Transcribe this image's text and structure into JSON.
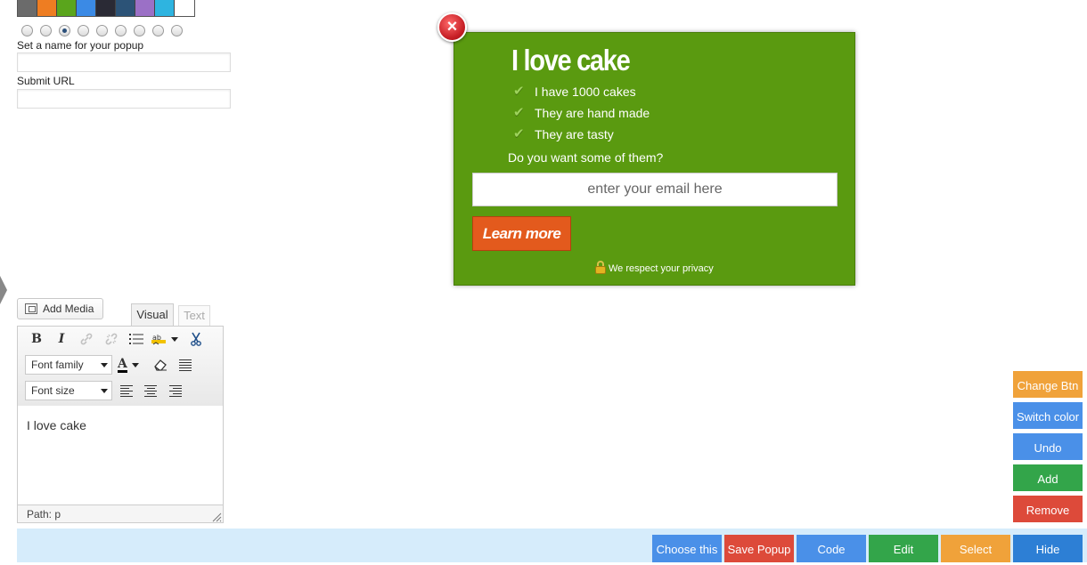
{
  "swatches": [
    "#6b6b6b",
    "#ee7d22",
    "#5aa51c",
    "#3b8ae5",
    "#2a2a35",
    "#2c5377",
    "#9b70c6",
    "#2eb4e0",
    "#ffffff"
  ],
  "radio_selected_index": 2,
  "radio_count": 9,
  "form": {
    "name_label": "Set a name for your popup",
    "name_value": "",
    "url_label": "Submit URL",
    "url_value": ""
  },
  "popup": {
    "close_icon": "×",
    "title": "I love cake",
    "features": [
      "I have 1000 cakes",
      "They are hand made",
      "They are tasty"
    ],
    "check_icon": "✔",
    "question": "Do you want some of them?",
    "email_placeholder": "enter your email here",
    "button_label": "Learn more",
    "privacy_text": "We respect your privacy",
    "bg_color": "#5a9a10",
    "button_color": "#e35a1d"
  },
  "editor": {
    "add_media_label": "Add Media",
    "tab_visual": "Visual",
    "tab_text": "Text",
    "bold": "B",
    "italic": "I",
    "font_family_label": "Font family",
    "font_size_label": "Font size",
    "text_color_letter": "A",
    "content": "I love cake",
    "path": "Path: p"
  },
  "side_buttons": [
    {
      "label": "Change Btn",
      "color": "#f0a23a"
    },
    {
      "label": "Switch color",
      "color": "#4a90e8"
    },
    {
      "label": "Undo",
      "color": "#4a90e8"
    },
    {
      "label": "Add",
      "color": "#33a54a"
    },
    {
      "label": "Remove",
      "color": "#dd4a3a"
    }
  ],
  "bottom_buttons": [
    {
      "label": "Choose this",
      "color": "#4a90e8"
    },
    {
      "label": "Save Popup",
      "color": "#dd4a3a"
    },
    {
      "label": "Code",
      "color": "#4a90e8"
    },
    {
      "label": "Edit",
      "color": "#33a54a"
    },
    {
      "label": "Select",
      "color": "#f0a23a"
    },
    {
      "label": "Hide",
      "color": "#2d7fd5"
    }
  ]
}
